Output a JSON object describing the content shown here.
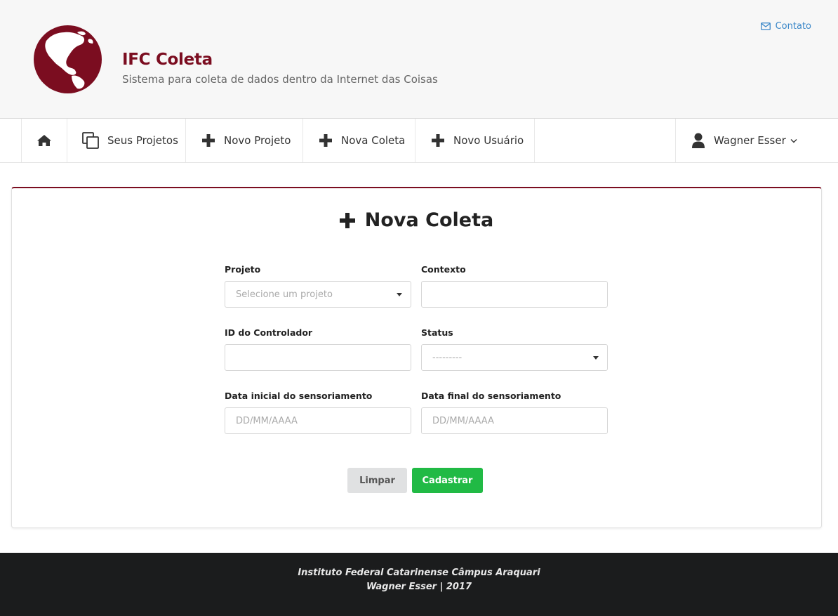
{
  "header": {
    "title": "IFC Coleta",
    "subtitle": "Sistema para coleta de dados dentro da Internet das Coisas",
    "contact_label": "Contato",
    "logo_icon": "globe-americas-icon"
  },
  "nav": {
    "home_icon": "home-icon",
    "items": [
      {
        "label": "Seus Projetos",
        "icon": "copy-icon"
      },
      {
        "label": "Novo Projeto",
        "icon": "plus-icon"
      },
      {
        "label": "Nova Coleta",
        "icon": "plus-icon"
      },
      {
        "label": "Novo Usuário",
        "icon": "plus-icon"
      }
    ],
    "user": {
      "name": "Wagner Esser",
      "icon": "user-icon"
    }
  },
  "form": {
    "title": "Nova Coleta",
    "fields": {
      "projeto": {
        "label": "Projeto",
        "placeholder": "Selecione um projeto"
      },
      "contexto": {
        "label": "Contexto",
        "value": ""
      },
      "controlador": {
        "label": "ID do Controlador",
        "value": ""
      },
      "status": {
        "label": "Status",
        "placeholder": "---------"
      },
      "data_inicial": {
        "label": "Data inicial do sensoriamento",
        "placeholder": "DD/MM/AAAA"
      },
      "data_final": {
        "label": "Data final do sensoriamento",
        "placeholder": "DD/MM/AAAA"
      }
    },
    "buttons": {
      "clear": "Limpar",
      "submit": "Cadastrar"
    }
  },
  "footer": {
    "line1": "Instituto Federal Catarinense Câmpus Araquari",
    "line2": "Wagner Esser | 2017"
  },
  "colors": {
    "brand": "#7b0d20",
    "link": "#3a87c8",
    "success": "#21ba45",
    "footer_bg": "#1b1c1d"
  }
}
